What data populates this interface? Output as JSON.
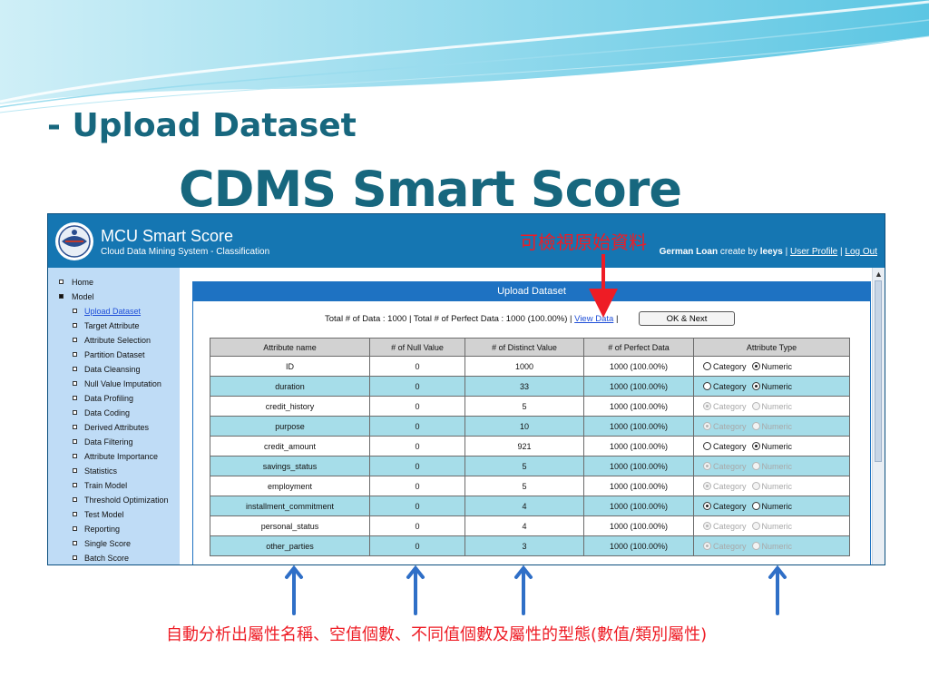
{
  "slide": {
    "title_main": "CDMS Smart Score",
    "title_sub": "- Upload Dataset",
    "note_view_data": "可檢視原始資料",
    "caption": "自動分析出屬性名稱、空值個數、不同值個數及屬性的型態(數值/類別屬性)",
    "colors": {
      "title": "#17677e",
      "annotation": "#ee1c25",
      "arrow_blue": "#2f6fc7"
    }
  },
  "app": {
    "title": "MCU Smart Score",
    "subtitle": "Cloud Data Mining System - Classification",
    "dataset": "German Loan",
    "create_by_prefix": "create by",
    "user": "leeys",
    "sep": "|",
    "user_profile": "User Profile",
    "log_out": "Log Out",
    "colors": {
      "header": "#1576b2",
      "sidebar": "#bfdcf6",
      "panel_head": "#1e72c2",
      "row_alt": "#a6dde9"
    }
  },
  "sidebar": {
    "items": [
      {
        "label": "Home",
        "level": "top"
      },
      {
        "label": "Model",
        "level": "top",
        "expanded": true
      },
      {
        "label": "Upload Dataset",
        "level": "sub",
        "active": true
      },
      {
        "label": "Target Attribute",
        "level": "sub"
      },
      {
        "label": "Attribute Selection",
        "level": "sub"
      },
      {
        "label": "Partition Dataset",
        "level": "sub"
      },
      {
        "label": "Data Cleansing",
        "level": "sub"
      },
      {
        "label": "Null Value Imputation",
        "level": "sub"
      },
      {
        "label": "Data Profiling",
        "level": "sub"
      },
      {
        "label": "Data Coding",
        "level": "sub"
      },
      {
        "label": "Derived Attributes",
        "level": "sub"
      },
      {
        "label": "Data Filtering",
        "level": "sub"
      },
      {
        "label": "Attribute Importance",
        "level": "sub"
      },
      {
        "label": "Statistics",
        "level": "sub"
      },
      {
        "label": "Train Model",
        "level": "sub"
      },
      {
        "label": "Threshold Optimization",
        "level": "sub"
      },
      {
        "label": "Test Model",
        "level": "sub"
      },
      {
        "label": "Reporting",
        "level": "sub"
      },
      {
        "label": "Single Score",
        "level": "sub"
      },
      {
        "label": "Batch Score",
        "level": "sub"
      }
    ]
  },
  "panel": {
    "title": "Upload Dataset",
    "summary_text": "Total # of Data : 1000  |  Total # of Perfect Data : 1000 (100.00%)  |",
    "view_data": "View Data",
    "sep": "|",
    "ok_button": "OK & Next"
  },
  "table": {
    "headers": [
      "Attribute name",
      "# of Null Value",
      "# of Distinct Value",
      "# of Perfect Data",
      "Attribute Type"
    ],
    "type_options": [
      "Category",
      "Numeric"
    ],
    "rows": [
      {
        "name": "ID",
        "nulls": "0",
        "distinct": "1000",
        "perfect": "1000 (100.00%)",
        "type": "Numeric",
        "enabled": true
      },
      {
        "name": "duration",
        "nulls": "0",
        "distinct": "33",
        "perfect": "1000 (100.00%)",
        "type": "Numeric",
        "enabled": true
      },
      {
        "name": "credit_history",
        "nulls": "0",
        "distinct": "5",
        "perfect": "1000 (100.00%)",
        "type": "Category",
        "enabled": false
      },
      {
        "name": "purpose",
        "nulls": "0",
        "distinct": "10",
        "perfect": "1000 (100.00%)",
        "type": "Category",
        "enabled": false
      },
      {
        "name": "credit_amount",
        "nulls": "0",
        "distinct": "921",
        "perfect": "1000 (100.00%)",
        "type": "Numeric",
        "enabled": true
      },
      {
        "name": "savings_status",
        "nulls": "0",
        "distinct": "5",
        "perfect": "1000 (100.00%)",
        "type": "Category",
        "enabled": false
      },
      {
        "name": "employment",
        "nulls": "0",
        "distinct": "5",
        "perfect": "1000 (100.00%)",
        "type": "Category",
        "enabled": false
      },
      {
        "name": "installment_commitment",
        "nulls": "0",
        "distinct": "4",
        "perfect": "1000 (100.00%)",
        "type": "Category",
        "enabled": true
      },
      {
        "name": "personal_status",
        "nulls": "0",
        "distinct": "4",
        "perfect": "1000 (100.00%)",
        "type": "Category",
        "enabled": false
      },
      {
        "name": "other_parties",
        "nulls": "0",
        "distinct": "3",
        "perfect": "1000 (100.00%)",
        "type": "Category",
        "enabled": false
      }
    ]
  }
}
